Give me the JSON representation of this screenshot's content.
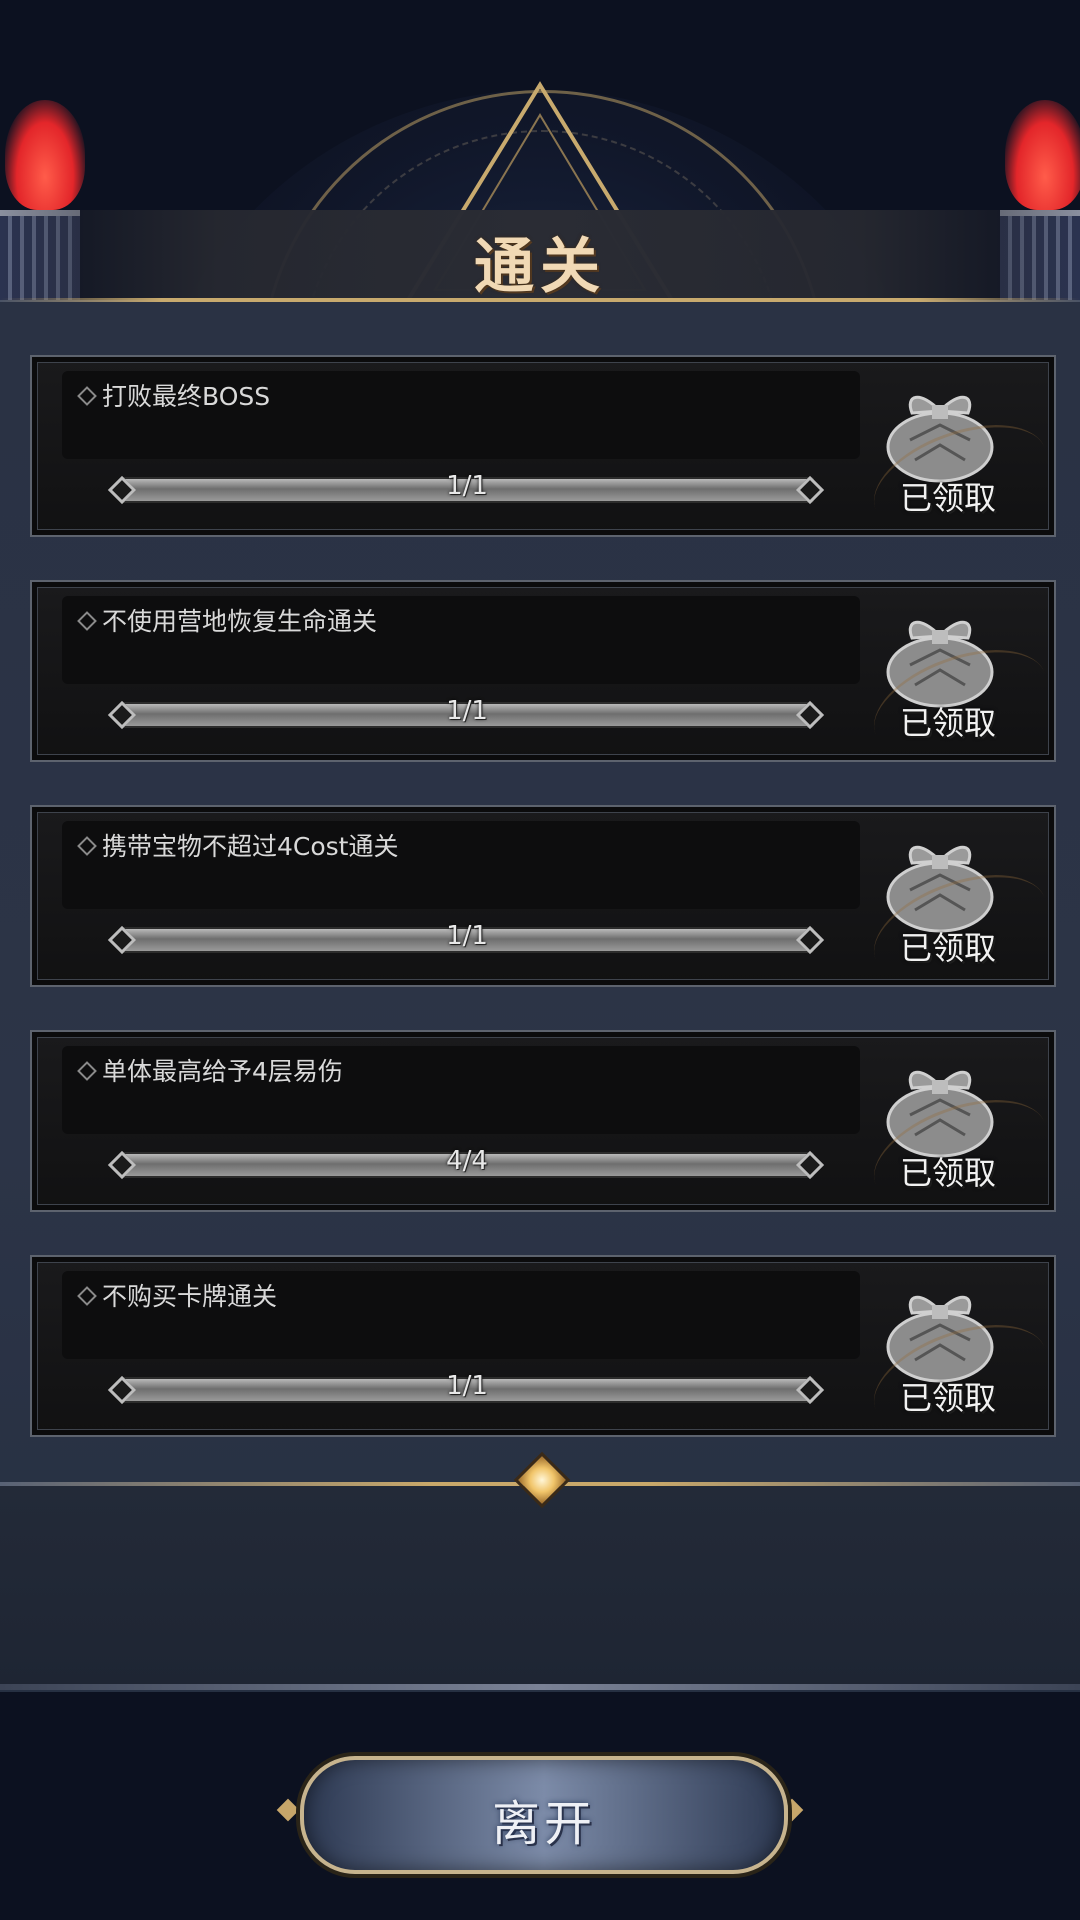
{
  "header": {
    "title": "通关"
  },
  "tasks": [
    {
      "label": "打败最终BOSS",
      "progress": "1/1",
      "status": "已领取",
      "fill": 1.0
    },
    {
      "label": "不使用营地恢复生命通关",
      "progress": "1/1",
      "status": "已领取",
      "fill": 1.0
    },
    {
      "label": "携带宝物不超过4Cost通关",
      "progress": "1/1",
      "status": "已领取",
      "fill": 1.0
    },
    {
      "label": "单体最高给予4层易伤",
      "progress": "4/4",
      "status": "已领取",
      "fill": 1.0
    },
    {
      "label": "不购买卡牌通关",
      "progress": "1/1",
      "status": "已领取",
      "fill": 1.0
    }
  ],
  "footer": {
    "leave_label": "离开"
  },
  "colors": {
    "title": "#f1d9b5",
    "accent_gold": "#c9a86a",
    "flame": "#e3262a",
    "panel": "#2a3244"
  },
  "icons": {
    "reward": "gift-pouch-icon",
    "bullet": "diamond-bullet-icon"
  }
}
